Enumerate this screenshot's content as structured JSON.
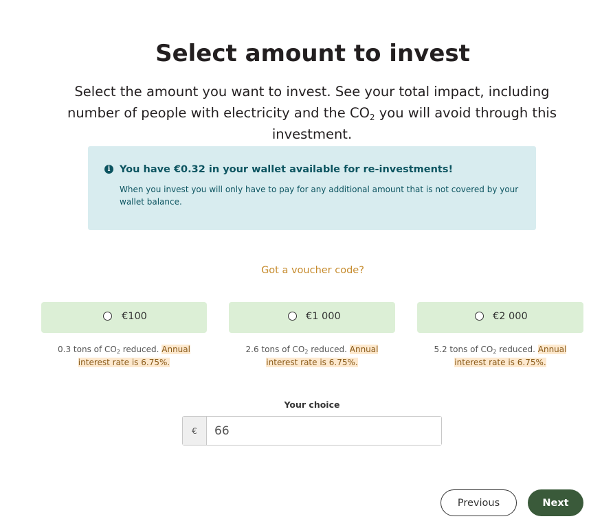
{
  "header": {
    "title": "Select amount to invest",
    "subtitle_before": "Select the amount you want to invest. See your total impact, including number of people with electricity and the CO",
    "subtitle_sub": "2",
    "subtitle_after": " you will avoid through this investment."
  },
  "wallet_notice": {
    "icon": "info-icon",
    "title": "You have €0.32 in your wallet available for re-investments!",
    "text": "When you invest you will only have to pay for any additional amount that is not covered by your wallet balance."
  },
  "voucher_link": "Got a voucher code?",
  "options": [
    {
      "label": "€100",
      "impact_before": "0.3 tons of CO",
      "impact_sub": "2",
      "impact_after": " reduced. ",
      "interest": "Annual interest rate is 6.75%."
    },
    {
      "label": "€1 000",
      "impact_before": "2.6 tons of CO",
      "impact_sub": "2",
      "impact_after": " reduced. ",
      "interest": "Annual interest rate is 6.75%."
    },
    {
      "label": "€2 000",
      "impact_before": "5.2 tons of CO",
      "impact_sub": "2",
      "impact_after": " reduced. ",
      "interest": "Annual interest rate is 6.75%."
    }
  ],
  "custom_amount": {
    "label": "Your choice",
    "currency_prefix": "€",
    "value": "66"
  },
  "buttons": {
    "previous": "Previous",
    "next": "Next"
  },
  "colors": {
    "info_background": "#d8ecef",
    "info_text": "#0c5460",
    "option_background": "#dcefd6",
    "voucher_link": "#c68b2d",
    "interest_highlight": "#fde9cf",
    "next_button": "#3a5a3a"
  }
}
